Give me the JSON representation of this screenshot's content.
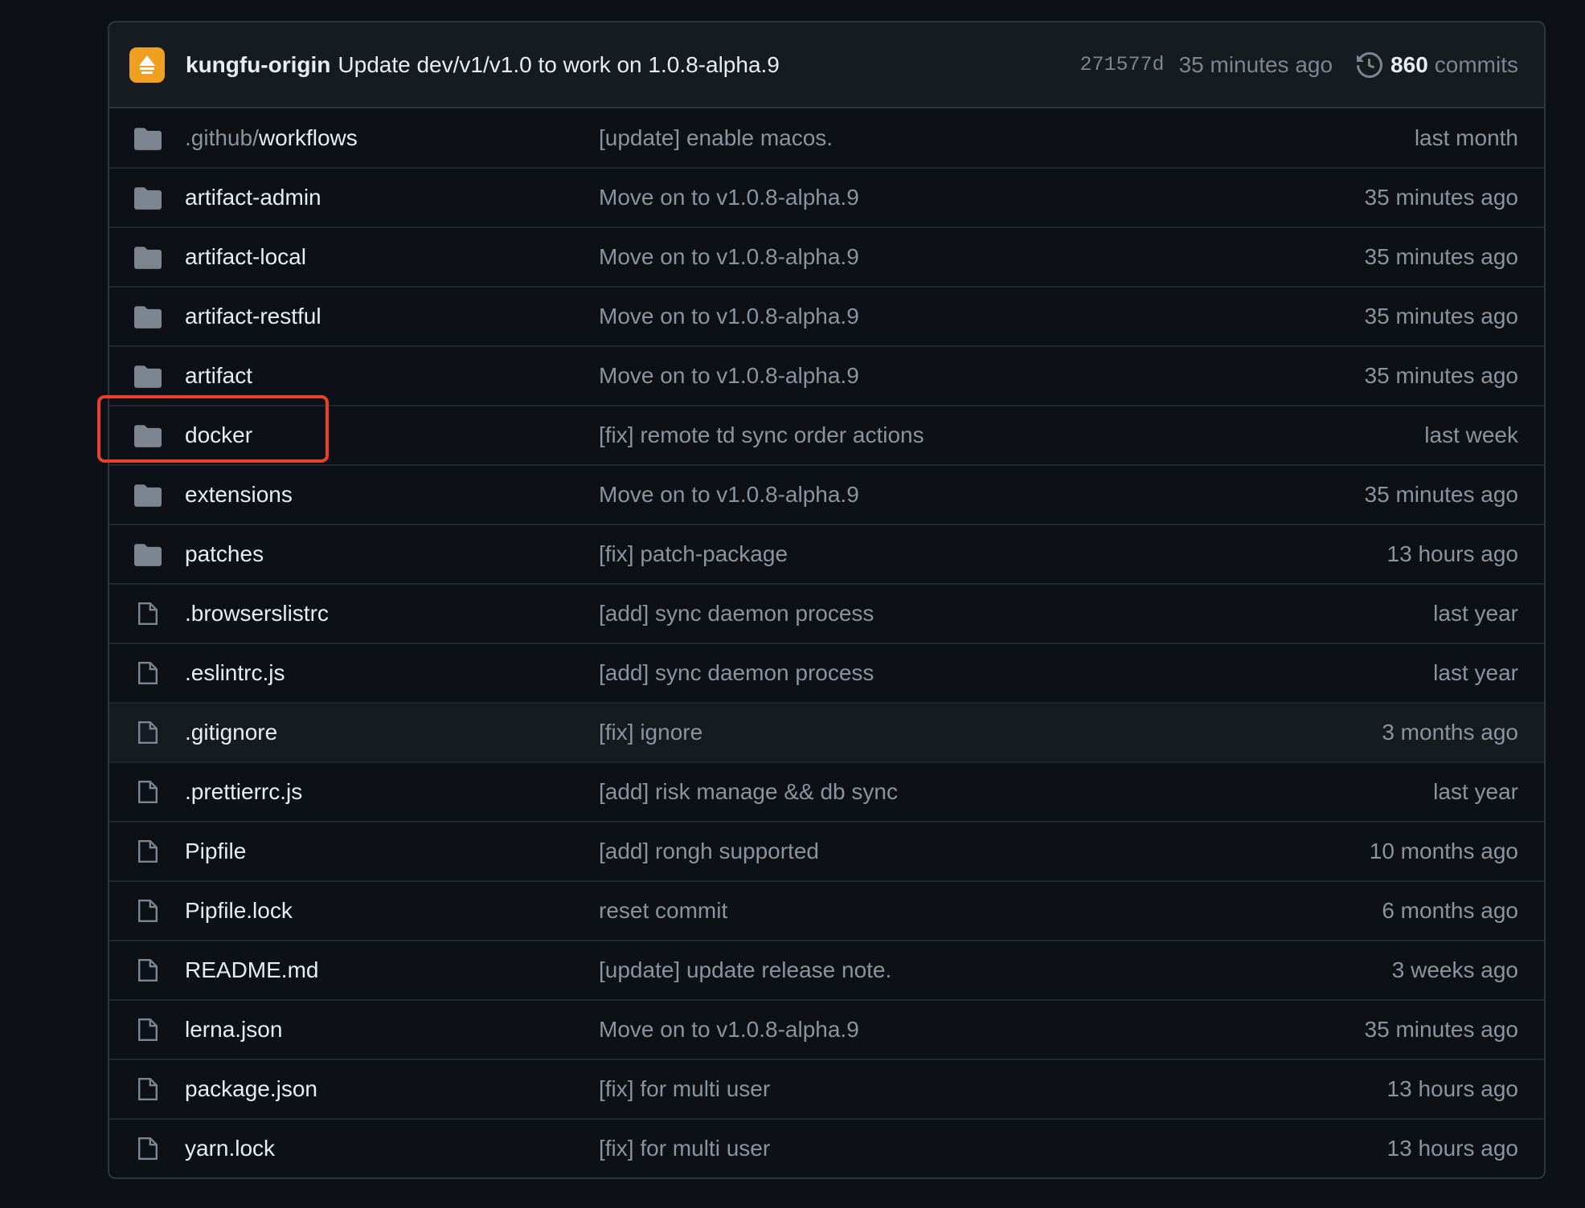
{
  "latest_commit": {
    "author": "kungfu-origin",
    "message": "Update dev/v1/v1.0 to work on 1.0.8-alpha.9",
    "sha": "271577d",
    "time": "35 minutes ago",
    "commit_count": "860",
    "commit_label": "commits"
  },
  "files": [
    {
      "type": "folder",
      "prefix": ".github/",
      "name": "workflows",
      "message": "[update] enable macos.",
      "age": "last month"
    },
    {
      "type": "folder",
      "prefix": "",
      "name": "artifact-admin",
      "message": "Move on to v1.0.8-alpha.9",
      "age": "35 minutes ago"
    },
    {
      "type": "folder",
      "prefix": "",
      "name": "artifact-local",
      "message": "Move on to v1.0.8-alpha.9",
      "age": "35 minutes ago"
    },
    {
      "type": "folder",
      "prefix": "",
      "name": "artifact-restful",
      "message": "Move on to v1.0.8-alpha.9",
      "age": "35 minutes ago"
    },
    {
      "type": "folder",
      "prefix": "",
      "name": "artifact",
      "message": "Move on to v1.0.8-alpha.9",
      "age": "35 minutes ago"
    },
    {
      "type": "folder",
      "prefix": "",
      "name": "docker",
      "message": "[fix] remote td sync order actions",
      "age": "last week"
    },
    {
      "type": "folder",
      "prefix": "",
      "name": "extensions",
      "message": "Move on to v1.0.8-alpha.9",
      "age": "35 minutes ago"
    },
    {
      "type": "folder",
      "prefix": "",
      "name": "patches",
      "message": "[fix] patch-package",
      "age": "13 hours ago"
    },
    {
      "type": "file",
      "prefix": "",
      "name": ".browserslistrc",
      "message": "[add] sync daemon process",
      "age": "last year"
    },
    {
      "type": "file",
      "prefix": "",
      "name": ".eslintrc.js",
      "message": "[add] sync daemon process",
      "age": "last year"
    },
    {
      "type": "file",
      "prefix": "",
      "name": ".gitignore",
      "message": "[fix] ignore",
      "age": "3 months ago"
    },
    {
      "type": "file",
      "prefix": "",
      "name": ".prettierrc.js",
      "message": "[add] risk manage && db sync",
      "age": "last year"
    },
    {
      "type": "file",
      "prefix": "",
      "name": "Pipfile",
      "message": "[add] rongh supported",
      "age": "10 months ago"
    },
    {
      "type": "file",
      "prefix": "",
      "name": "Pipfile.lock",
      "message": "reset commit",
      "age": "6 months ago"
    },
    {
      "type": "file",
      "prefix": "",
      "name": "README.md",
      "message": "[update] update release note.",
      "age": "3 weeks ago"
    },
    {
      "type": "file",
      "prefix": "",
      "name": "lerna.json",
      "message": "Move on to v1.0.8-alpha.9",
      "age": "35 minutes ago"
    },
    {
      "type": "file",
      "prefix": "",
      "name": "package.json",
      "message": "[fix] for multi user",
      "age": "13 hours ago"
    },
    {
      "type": "file",
      "prefix": "",
      "name": "yarn.lock",
      "message": "[fix] for multi user",
      "age": "13 hours ago"
    }
  ],
  "hovered_row": ".gitignore",
  "highlighted_row": "docker",
  "colors": {
    "background": "#0d1117",
    "header": "#161b22",
    "border": "#30363d",
    "text": "#e6edf3",
    "muted": "#8b949e",
    "highlight": "#e8402c",
    "avatar": "#f0a020"
  }
}
